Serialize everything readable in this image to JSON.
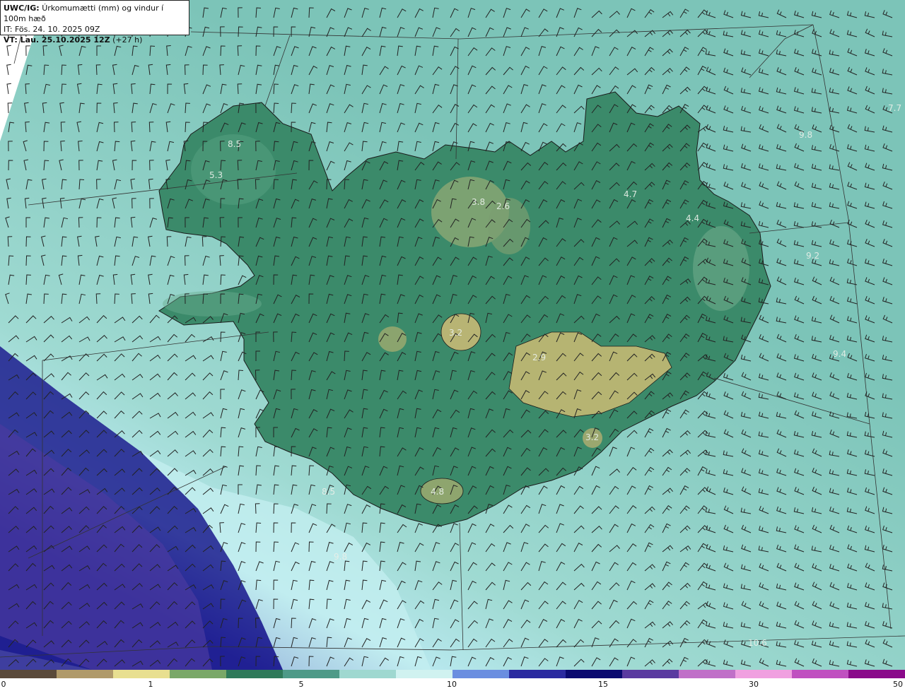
{
  "header": {
    "line1_prefix": "UWC/IG:",
    "line1_text": "Úrkomumætti (mm) og vindur í 100m hæð",
    "line2": "IT: Fös. 24. 10. 2025 09Z",
    "line3_prefix": "VT: Lau. 25.10.2025 12Z",
    "line3_suffix": "(+27 h)"
  },
  "map_labels": [
    {
      "text": "8.5"
    },
    {
      "text": "5.3"
    },
    {
      "text": "3.8"
    },
    {
      "text": "2.6"
    },
    {
      "text": "4.7"
    },
    {
      "text": "4.4"
    },
    {
      "text": "7.7"
    },
    {
      "text": "9.8"
    },
    {
      "text": "9.2"
    },
    {
      "text": "3.2"
    },
    {
      "text": "2.9"
    },
    {
      "text": "9.4"
    },
    {
      "text": "3.2"
    },
    {
      "text": "4.8"
    },
    {
      "text": "8.5"
    },
    {
      "text": "9.8"
    },
    {
      "text": "10.6"
    }
  ],
  "colorbar": {
    "ticks": [
      "0",
      "1",
      "5",
      "10",
      "15",
      "30",
      "50"
    ],
    "colors": [
      "#5a4a3a",
      "#b09a6a",
      "#e8df90",
      "#7aa868",
      "#2f7a5a",
      "#4e9a88",
      "#9fd8d0",
      "#d0f2f0",
      "#6a8ee0",
      "#2a2aa0",
      "#0a0a70",
      "#5a3aa0",
      "#c070c8",
      "#f0a0e0",
      "#c050c0",
      "#8a0a8a"
    ]
  },
  "colors": {
    "sea": "#8fd0c6",
    "land": "#3f8c6c",
    "highland": "#a4ad6e",
    "deep_band": "#1a1a8c",
    "light_band": "#c6f0ee"
  }
}
